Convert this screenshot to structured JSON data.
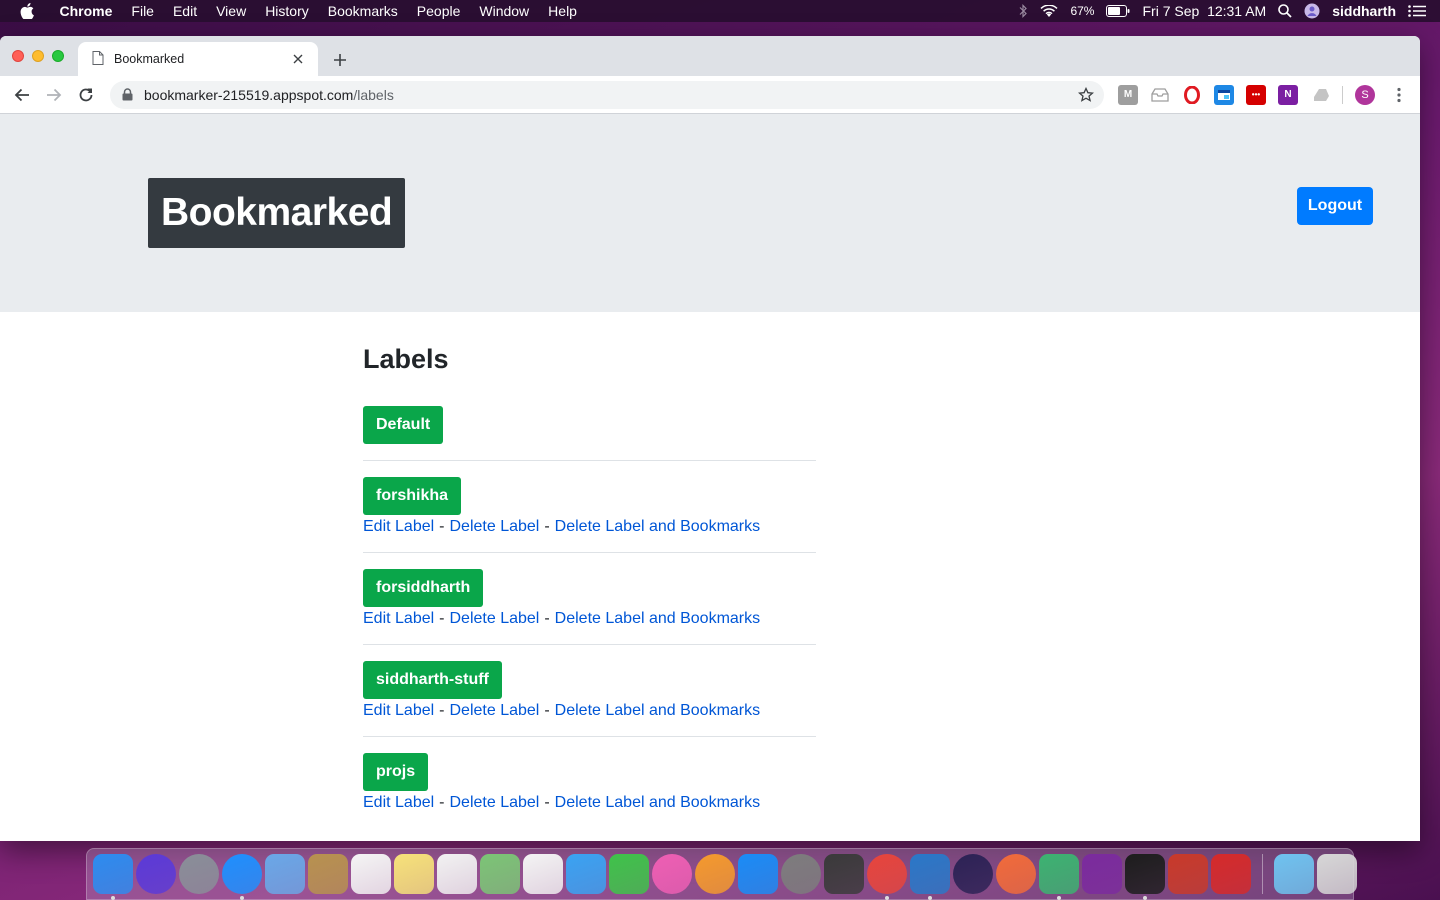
{
  "menubar": {
    "app_name": "Chrome",
    "items": [
      "File",
      "Edit",
      "View",
      "History",
      "Bookmarks",
      "People",
      "Window",
      "Help"
    ],
    "battery": "67%",
    "datetime": "Fri 7 Sep  12:31 AM",
    "user": "siddharth"
  },
  "browser": {
    "tab_title": "Bookmarked",
    "url_host": "bookmarker-215519.appspot.com",
    "url_path": "/labels",
    "profile_initial": "S",
    "extensions": [
      {
        "name": "m-extension-icon",
        "letter": "M",
        "color": "#9e9e9e"
      },
      {
        "name": "inbox-extension-icon",
        "letter": "",
        "color": "#b0b0b0"
      },
      {
        "name": "opera-extension-icon",
        "letter": "O",
        "color": "#e01a22"
      },
      {
        "name": "window-extension-icon",
        "letter": "",
        "color": "#1e88e5"
      },
      {
        "name": "dots-extension-icon",
        "letter": "•••",
        "color": "#d50000"
      },
      {
        "name": "onenote-extension-icon",
        "letter": "N",
        "color": "#7b1fa2"
      },
      {
        "name": "drive-extension-icon",
        "letter": "",
        "color": "#bdbdbd"
      }
    ]
  },
  "header": {
    "brand": "Bookmarked",
    "logout_label": "Logout"
  },
  "main": {
    "title": "Labels",
    "labels": [
      {
        "name": "Default",
        "actions": []
      },
      {
        "name": "forshikha",
        "actions": [
          "Edit Label",
          "Delete Label",
          "Delete Label and Bookmarks"
        ]
      },
      {
        "name": "forsiddharth",
        "actions": [
          "Edit Label",
          "Delete Label",
          "Delete Label and Bookmarks"
        ]
      },
      {
        "name": "siddharth-stuff",
        "actions": [
          "Edit Label",
          "Delete Label",
          "Delete Label and Bookmarks"
        ]
      },
      {
        "name": "projs",
        "actions": [
          "Edit Label",
          "Delete Label",
          "Delete Label and Bookmarks"
        ]
      }
    ],
    "action_separator": "-"
  },
  "dock": {
    "apps": [
      {
        "name": "finder-icon",
        "color": "#2d8cf0",
        "running": true
      },
      {
        "name": "siri-icon",
        "color": "#5b3ad8",
        "running": false
      },
      {
        "name": "launchpad-icon",
        "color": "#8a8f99",
        "running": false
      },
      {
        "name": "safari-icon",
        "color": "#1e90ff",
        "running": true
      },
      {
        "name": "mail-icon",
        "color": "#6aa8e8",
        "running": false
      },
      {
        "name": "contacts-icon",
        "color": "#b8924f",
        "running": false
      },
      {
        "name": "calendar-icon",
        "color": "#f5f5f5",
        "running": false
      },
      {
        "name": "notes-icon",
        "color": "#f7e27a",
        "running": false
      },
      {
        "name": "reminders-icon",
        "color": "#f2f2f2",
        "running": false
      },
      {
        "name": "maps-icon",
        "color": "#7cc576",
        "running": false
      },
      {
        "name": "photos-icon",
        "color": "#f4f4f4",
        "running": false
      },
      {
        "name": "messages-icon",
        "color": "#3aa3f3",
        "running": false
      },
      {
        "name": "facetime-icon",
        "color": "#3fc34a",
        "running": false
      },
      {
        "name": "itunes-icon",
        "color": "#ef5fb4",
        "running": false
      },
      {
        "name": "books-icon",
        "color": "#f59a2d",
        "running": false
      },
      {
        "name": "app-store-icon",
        "color": "#1a8cf7",
        "running": false
      },
      {
        "name": "system-preferences-icon",
        "color": "#7d7d7d",
        "running": false
      },
      {
        "name": "sublime-text-icon",
        "color": "#3a3a3a",
        "running": false
      },
      {
        "name": "chrome-icon",
        "color": "#e8453c",
        "running": true
      },
      {
        "name": "vscode-icon",
        "color": "#2a78c8",
        "running": true
      },
      {
        "name": "eclipse-icon",
        "color": "#2c2255",
        "running": false
      },
      {
        "name": "postman-icon",
        "color": "#f26b3a",
        "running": false
      },
      {
        "name": "robo3t-icon",
        "color": "#3cb371",
        "running": true
      },
      {
        "name": "onenote-icon",
        "color": "#7b2b9e",
        "running": false
      },
      {
        "name": "terminal-icon",
        "color": "#1d1d1d",
        "running": true
      },
      {
        "name": "windows-app-icon",
        "color": "#c93a2a",
        "running": false
      },
      {
        "name": "boxing-gloves-icon",
        "color": "#d62a2a",
        "running": false
      },
      {
        "name": "folder-icon",
        "color": "#6fc3f0",
        "running": false
      },
      {
        "name": "trash-icon",
        "color": "#d7d7d7",
        "running": false
      }
    ]
  }
}
